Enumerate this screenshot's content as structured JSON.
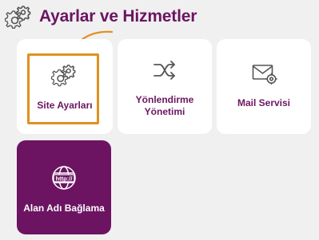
{
  "header": {
    "title": "Ayarlar ve Hizmetler",
    "icon": "gears-icon"
  },
  "cards": [
    {
      "label_lines": [
        "Site Ayarları"
      ],
      "icon": "gears-icon",
      "highlighted": true
    },
    {
      "label_lines": [
        "Yönlendirme",
        "Yönetimi"
      ],
      "icon": "shuffle-icon"
    },
    {
      "label_lines": [
        "Mail Servisi"
      ],
      "icon": "mail-settings-icon"
    },
    {
      "label_lines": [
        "Alan Adı Bağlama"
      ],
      "icon": "http-globe-icon",
      "active": true
    }
  ],
  "colors": {
    "brand": "#6b1560",
    "active_card": "#6c1462",
    "highlight": "#e0911f",
    "background": "#f0f0f1",
    "icon_gray": "#555555"
  }
}
